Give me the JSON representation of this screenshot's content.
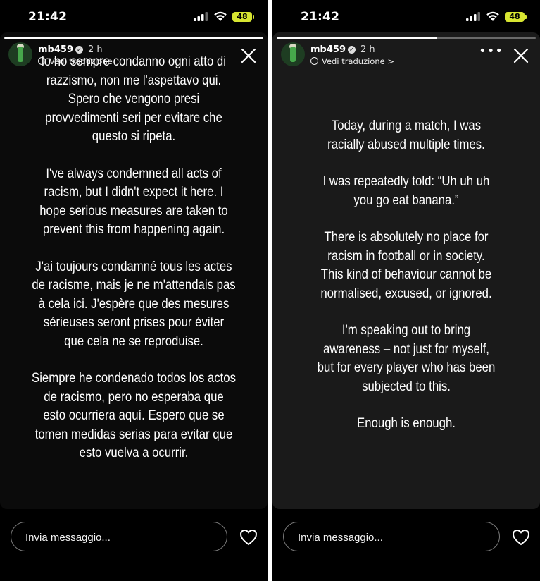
{
  "status_bar": {
    "time": "21:42",
    "battery": "48"
  },
  "story_left": {
    "username": "mb459",
    "age": "2 h",
    "translate_label": "Vedi traduzione",
    "paragraphs": [
      "lo ho sempre condanno ogni atto di\nrazzismo, non me l'aspettavo qui.\nSpero che vengono presi\nprovvedimenti seri per evitare che\nquesto si ripeta.",
      "I've always condemned all acts of\nracism, but I didn't expect it here. I\nhope serious measures are taken to\nprevent this from happening again.",
      "J'ai toujours condamné tous les actes\nde racisme, mais je ne m'attendais pas\nà cela ici. J'espère que des mesures\nsérieuses seront prises pour éviter\nque cela ne se reproduise.",
      "Siempre he condenado todos los actos\nde racismo, pero no esperaba que\nesto ocurriera aquí. Espero que se\ntomen medidas serias para evitar que\nesto vuelva a ocurrir."
    ],
    "progress": 1.0,
    "reply_placeholder": "Invia messaggio..."
  },
  "story_right": {
    "username": "mb459",
    "age": "2 h",
    "translate_label": "Vedi traduzione >",
    "more_label": "•••",
    "paragraphs": [
      "Today, during a match, I was\nracially abused multiple times.",
      "I was repeatedly told: “Uh uh uh\nyou go eat banana.”",
      "There is absolutely no place for\nracism in football or in society.\nThis kind of behaviour cannot be\nnormalised, excused, or ignored.",
      "I'm speaking out to bring\nawareness – not just for myself,\nbut for every player who has been\nsubjected to this.",
      "Enough is enough."
    ],
    "progress": 0.62,
    "reply_placeholder": "Invia messaggio..."
  },
  "colors": {
    "battery": "#d7e531",
    "story_bg_left": "#0b0b0b",
    "story_bg_right": "#1a1a1a"
  },
  "icons": [
    "signal-icon",
    "wifi-icon",
    "battery-icon",
    "verified-icon",
    "globe-icon",
    "close-icon",
    "more-icon",
    "heart-icon"
  ]
}
